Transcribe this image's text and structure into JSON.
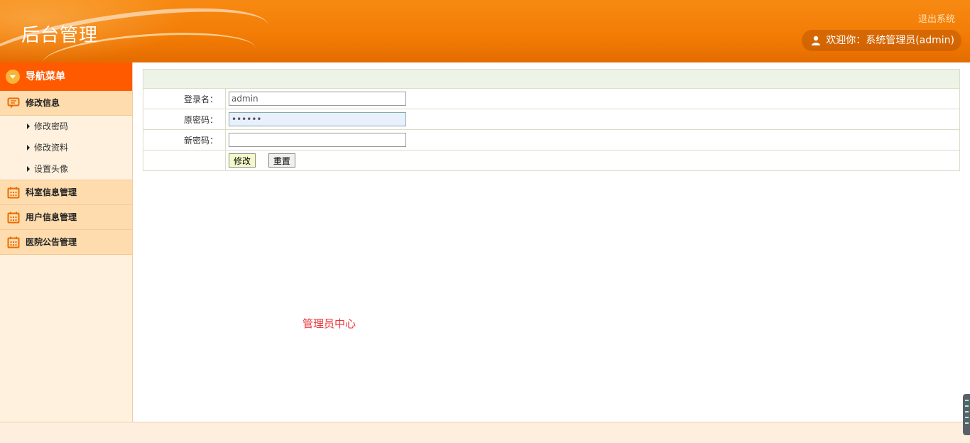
{
  "header": {
    "title": "后台管理",
    "logout_label": "退出系统",
    "welcome_text": "欢迎你：系统管理员(admin)"
  },
  "sidebar": {
    "nav_title": "导航菜单",
    "groups": [
      {
        "label": "修改信息",
        "icon": "message-icon",
        "items": [
          "修改密码",
          "修改资料",
          "设置头像"
        ]
      },
      {
        "label": "科室信息管理",
        "icon": "calendar-icon"
      },
      {
        "label": "用户信息管理",
        "icon": "calendar-icon"
      },
      {
        "label": "医院公告管理",
        "icon": "calendar-icon"
      }
    ]
  },
  "form": {
    "username_label": "登录名：",
    "username_value": "admin",
    "old_password_label": "原密码：",
    "old_password_value": "••••••",
    "new_password_label": "新密码：",
    "new_password_value": "",
    "submit_label": "修改",
    "reset_label": "重置"
  },
  "center_text": "管理员中心",
  "colors": {
    "header_orange": "#f27b05",
    "nav_head": "#ff5a00",
    "menu_group": "#ffdcae",
    "sidebar_bg": "#fff1de",
    "accent_red": "#e8363a"
  }
}
